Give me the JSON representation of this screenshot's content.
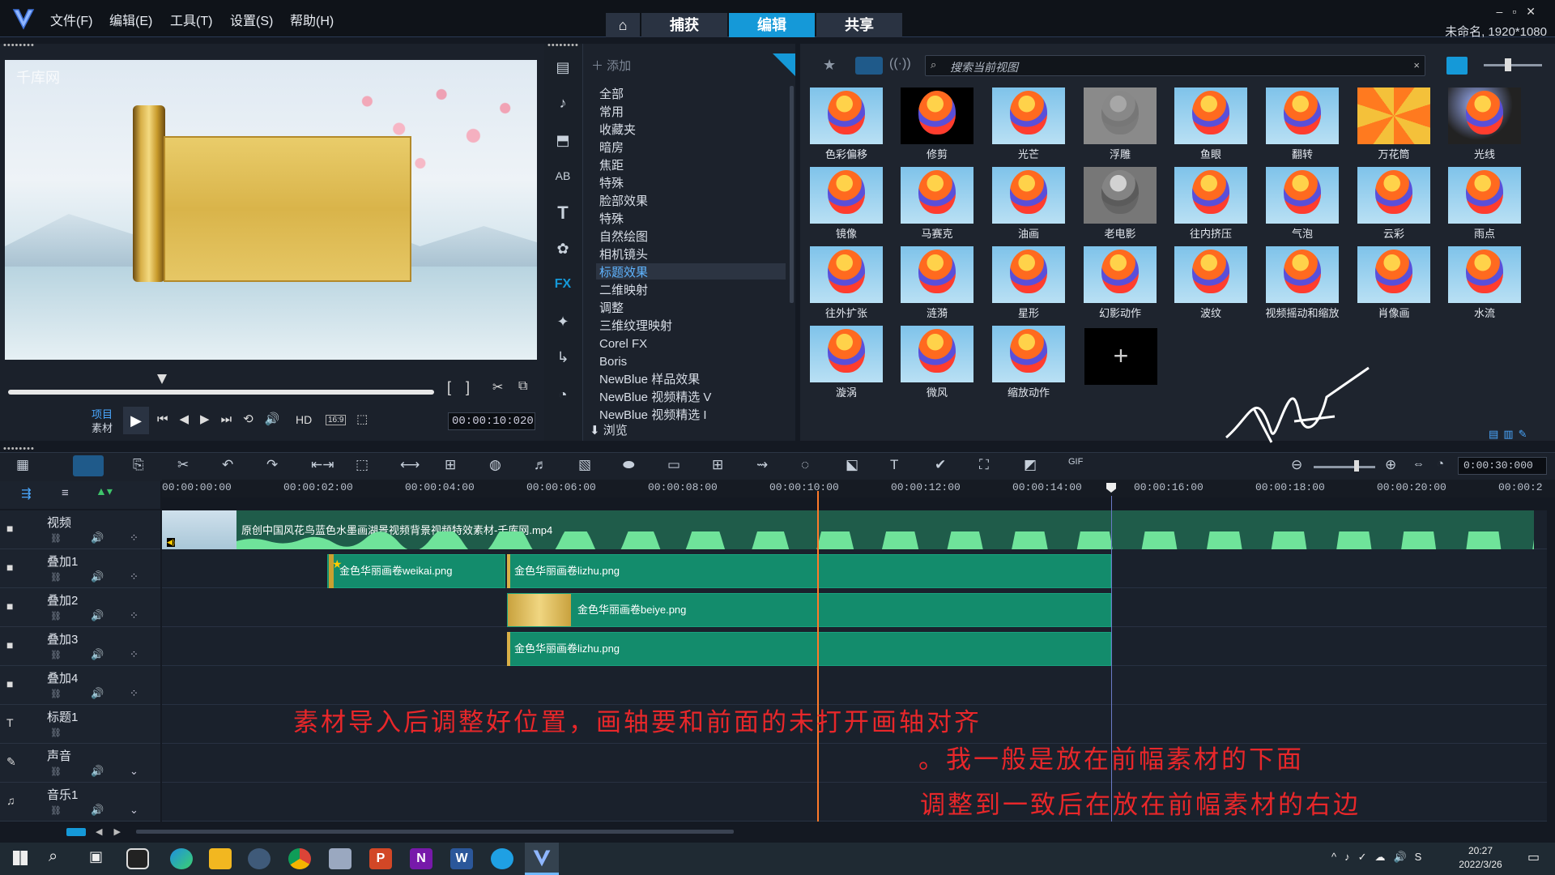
{
  "menubar": {
    "file": "文件(F)",
    "edit": "编辑(E)",
    "tools": "工具(T)",
    "settings": "设置(S)",
    "help": "帮助(H)"
  },
  "tabs": {
    "home": "⌂",
    "capture": "捕获",
    "edit": "编辑",
    "share": "共享"
  },
  "window": {
    "controls": "–▫✕",
    "project_name": "未命名, 1920*1080"
  },
  "preview": {
    "watermark": "千库网",
    "project_label": "项目",
    "clip_label": "素材",
    "hd": "HD",
    "aspect": "16:9",
    "timecode": "00:00:10:020"
  },
  "library": {
    "add_label": "添加",
    "categories": [
      "全部",
      "常用",
      "收藏夹",
      "暗房",
      "焦距",
      "特殊",
      "脸部效果",
      "特殊",
      "自然绘图",
      "相机镜头",
      "标题效果",
      "二维映射",
      "调整",
      "三维纹理映射",
      "Corel FX",
      "Boris",
      "NewBlue 样品效果",
      "NewBlue 视频精选 V",
      "NewBlue 视频精选 I"
    ],
    "selected_category_index": 10,
    "browse_label": "浏览",
    "search_placeholder": "搜索当前视图",
    "effects": [
      "色彩偏移",
      "修剪",
      "光芒",
      "浮雕",
      "鱼眼",
      "翻转",
      "万花筒",
      "光线",
      "镜像",
      "马赛克",
      "油画",
      "老电影",
      "往内挤压",
      "气泡",
      "云彩",
      "雨点",
      "往外扩张",
      "涟漪",
      "星形",
      "幻影动作",
      "波纹",
      "视频摇动和缩放",
      "肖像画",
      "水流",
      "漩涡",
      "微风",
      "缩放动作"
    ],
    "add_effect": "+"
  },
  "timeline": {
    "duration": "0:00:30:000",
    "ruler": [
      "00:00:00:00",
      "00:00:02:00",
      "00:00:04:00",
      "00:00:06:00",
      "00:00:08:00",
      "00:00:10:00",
      "00:00:12:00",
      "00:00:14:00",
      "00:00:16:00",
      "00:00:18:00",
      "00:00:20:00",
      "00:00:2"
    ],
    "tracks": [
      "视频",
      "叠加1",
      "叠加2",
      "叠加3",
      "叠加4",
      "标题1",
      "声音",
      "音乐1"
    ],
    "clips": {
      "video": "原创中国风花鸟蓝色水墨画湖景视频背景视频特效素材-千库网.mp4",
      "ov1a": "金色华丽画卷weikai.png",
      "ov1b": "金色华丽画卷lizhu.png",
      "ov2": "金色华丽画卷beiye.png",
      "ov3": "金色华丽画卷lizhu.png"
    }
  },
  "annotations": {
    "line1": "素材导入后调整好位置，画轴要和前面的未打开画轴对齐",
    "line2": "。我一般是放在前幅素材的下面",
    "line3": "调整到一致后在放在前幅素材的右边"
  },
  "taskbar": {
    "time": "20:27",
    "date": "2022/3/26"
  },
  "colors": {
    "accent": "#1599d8",
    "clip": "#138c6c",
    "annotation": "#e8272a",
    "playhead": "#ff7a2a"
  }
}
